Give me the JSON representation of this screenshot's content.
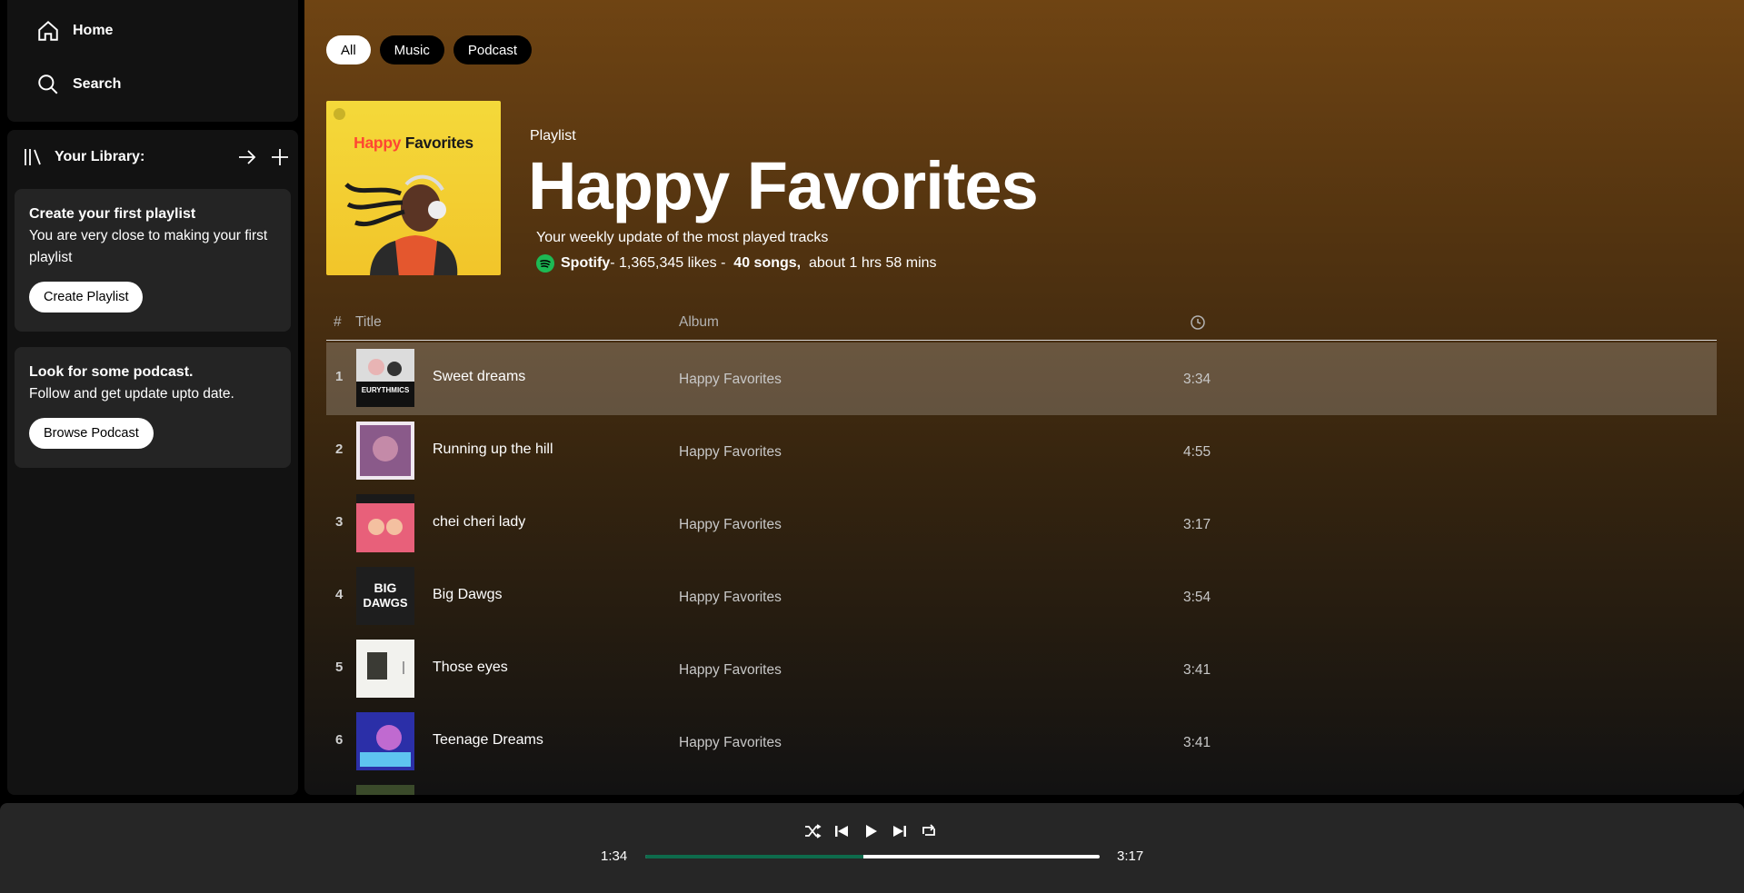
{
  "nav": {
    "home": "Home",
    "search": "Search"
  },
  "library": {
    "title": "Your Library:",
    "cards": [
      {
        "title": "Create your first playlist",
        "text": "You are very close to making your first playlist",
        "button": "Create Playlist"
      },
      {
        "title": "Look for some podcast.",
        "text": "Follow and get update upto date.",
        "button": "Browse Podcast"
      }
    ]
  },
  "filters": [
    "All",
    "Music",
    "Podcast"
  ],
  "playlist": {
    "type": "Playlist",
    "title": "Happy Favorites",
    "cover_text_a": "Happy",
    "cover_text_b": "Favorites",
    "description": "Your weekly update of the most played tracks",
    "owner": "Spotify",
    "likes": "- 1,365,345 likes -",
    "songs": "40 songs,",
    "duration": "about 1 hrs 58 mins"
  },
  "table": {
    "num": "#",
    "title": "Title",
    "album": "Album",
    "time_icon": "clock-icon"
  },
  "tracks": [
    {
      "num": "1",
      "title": "Sweet dreams",
      "album": "Happy Favorites",
      "duration": "3:34"
    },
    {
      "num": "2",
      "title": "Running up the hill",
      "album": "Happy Favorites",
      "duration": "4:55"
    },
    {
      "num": "3",
      "title": "chei cheri lady",
      "album": "Happy Favorites",
      "duration": "3:17"
    },
    {
      "num": "4",
      "title": "Big Dawgs",
      "album": "Happy Favorites",
      "duration": "3:54"
    },
    {
      "num": "5",
      "title": "Those eyes",
      "album": "Happy Favorites",
      "duration": "3:41"
    },
    {
      "num": "6",
      "title": "Teenage Dreams",
      "album": "Happy Favorites",
      "duration": "3:41"
    }
  ],
  "player": {
    "current": "1:34",
    "total": "3:17",
    "progress_fraction": 0.48
  },
  "colors": {
    "accent": "#1db954",
    "progress": "#0e6b4c"
  }
}
